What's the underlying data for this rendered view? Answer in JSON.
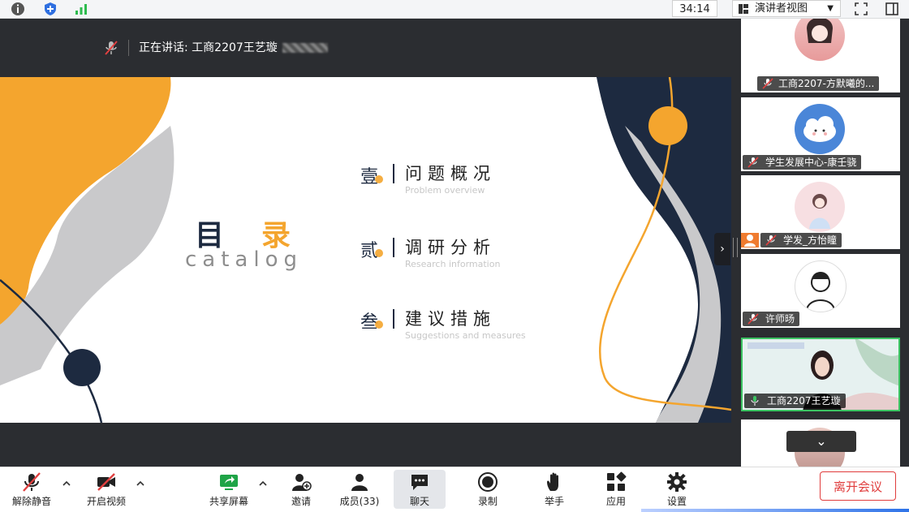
{
  "top": {
    "timer": "34:14",
    "view_selector": "演讲者视图"
  },
  "speaking": {
    "label": "正在讲话: 工商2207王艺璇"
  },
  "slide": {
    "title_left": "目",
    "title_right": "录",
    "subtitle": "catalog",
    "items": [
      {
        "num": "壹",
        "zh": "问题概况",
        "en": "Problem overview"
      },
      {
        "num": "贰",
        "zh": "调研分析",
        "en": "Research information"
      },
      {
        "num": "叁",
        "zh": "建议措施",
        "en": "Suggestions and measures"
      }
    ],
    "colors": {
      "navy": "#1d2a40",
      "orange": "#f4a52e",
      "gray": "#c9c9cb"
    }
  },
  "participants": [
    {
      "name": "工商2207-方默曦的..."
    },
    {
      "name": "学生发展中心-康壬骁"
    },
    {
      "name": "学发_方怡瞳"
    },
    {
      "name": "许师旸"
    },
    {
      "name": "工商2207王艺璇"
    }
  ],
  "toolbar": {
    "unmute": "解除静音",
    "video": "开启视频",
    "share": "共享屏幕",
    "invite": "邀请",
    "members": "成员(33)",
    "chat": "聊天",
    "record": "录制",
    "raise_hand": "举手",
    "apps": "应用",
    "settings": "设置",
    "leave": "离开会议"
  }
}
